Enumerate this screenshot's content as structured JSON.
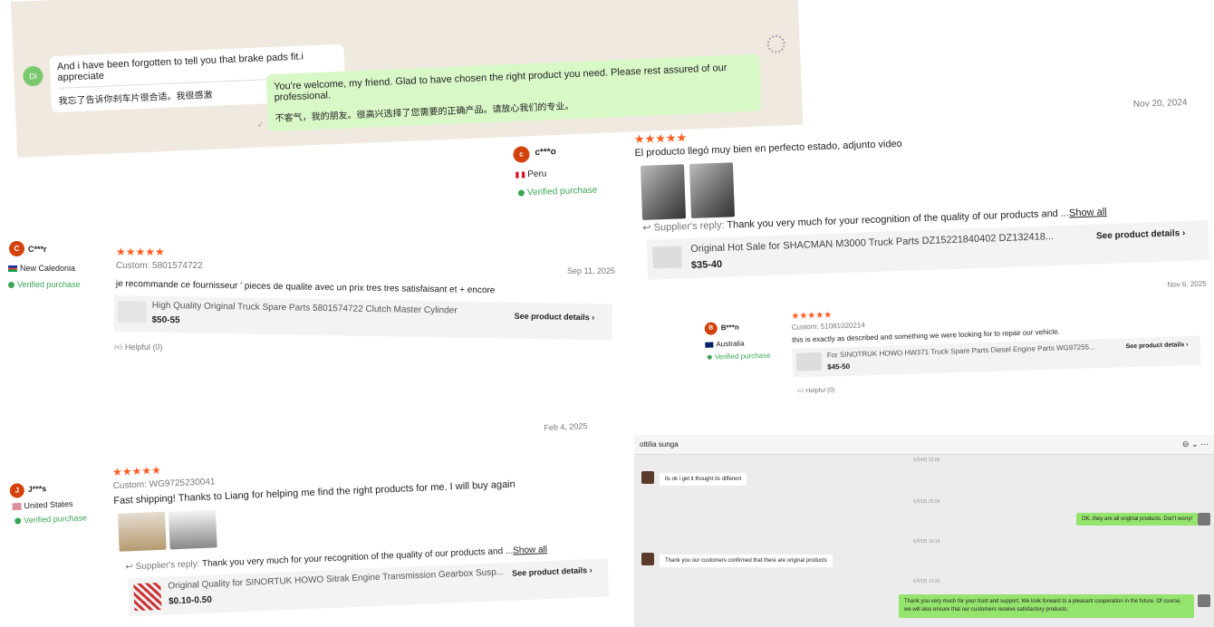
{
  "chat1": {
    "avatar": "Di",
    "in_en": "And i have been forgotten to tell you that brake pads fit.i appreciate",
    "in_zh": "我忘了告诉你刹车片很合适。我很感激",
    "out_en": "You're welcome, my friend. Glad to have chosen the right product you need. Please rest assured of our professional.",
    "out_zh": "不客气，我的朋友。很高兴选择了您需要的正确产品。请放心我们的专业。"
  },
  "rev_peru": {
    "date": "Nov 20, 2024",
    "initial": "c",
    "name": "c***o",
    "country": "Peru",
    "verified": "Verified purchase",
    "stars": "★★★★★",
    "text": "El producto llegó muy bien en perfecto estado, adjunto video",
    "supplier_label": "Supplier's reply:",
    "supplier_reply": "Thank you very much for your recognition of the quality of our products and ...",
    "show_all": "Show all",
    "product": "Original Hot Sale for SHACMAN M3000 Truck Parts DZ15221840402 DZ132418...",
    "price": "$35-40",
    "see_details": "See product details"
  },
  "rev_nc": {
    "date": "Sep 11, 2025",
    "initial": "C",
    "name": "C***r",
    "country": "New Caledonia",
    "verified": "Verified purchase",
    "stars": "★★★★★",
    "custom_label": "Custom:",
    "custom_value": "5801574722",
    "text": "je recommande ce fournisseur ' pieces de qualite avec un prix tres tres satisfaisant et + encore",
    "product": "High Quality Original Truck Spare Parts 5801574722 Clutch Master Cylinder",
    "price": "$50-55",
    "see_details": "See product details",
    "helpful": "Helpful (0)"
  },
  "rev_au": {
    "date": "Nov 6, 2025",
    "initial": "B",
    "name": "B***n",
    "country": "Australia",
    "verified": "Verified purchase",
    "stars": "★★★★★",
    "custom_label": "Custom:",
    "custom_value": "51081020214",
    "text": "this is exactly as described and something we were looking for to repair our vehicle.",
    "product": "For SINOTRUK HOWO HW371 Truck Spare Parts Diesel Engine Parts WG97255...",
    "price": "$45-50",
    "see_details": "See product details",
    "helpful": "Helpful (0)"
  },
  "rev_us": {
    "date": "Feb 4, 2025",
    "initial": "J",
    "name": "J***s",
    "country": "United States",
    "verified": "Verified purchase",
    "stars": "★★★★★",
    "custom_label": "Custom:",
    "custom_value": "WG9725230041",
    "text": "Fast shipping! Thanks to Liang for helping me find the right products for me. I will buy again",
    "supplier_label": "Supplier's reply:",
    "supplier_reply": "Thank you very much for your recognition of the quality of our products and ...",
    "show_all": "Show all",
    "product": "Original Quality for SINORTUK HOWO Sitrak Engine Transmission Gearbox Susp...",
    "price": "$0.10-0.50",
    "see_details": "See product details"
  },
  "chat2": {
    "contact": "ottilia sunga",
    "ts1": "6月4日 22:08",
    "m1": "its ok i get it thought its different",
    "ts2": "6月5日 05:04",
    "m2": "OK, they are all original products. Don't worry!",
    "ts3": "6月5日 10:14",
    "m3": "Thank you our customers confirmed that there are original products",
    "ts4": "6月5日 10:20",
    "m4": "Thank you very much for your trust and support. We look forward to a pleasant cooperation in the future. Of course, we will also ensure that our customers receive satisfactory products."
  },
  "colors": {
    "accent": "#ff5a1f",
    "verified": "#3aa655",
    "bubble_out": "#95e46e"
  }
}
